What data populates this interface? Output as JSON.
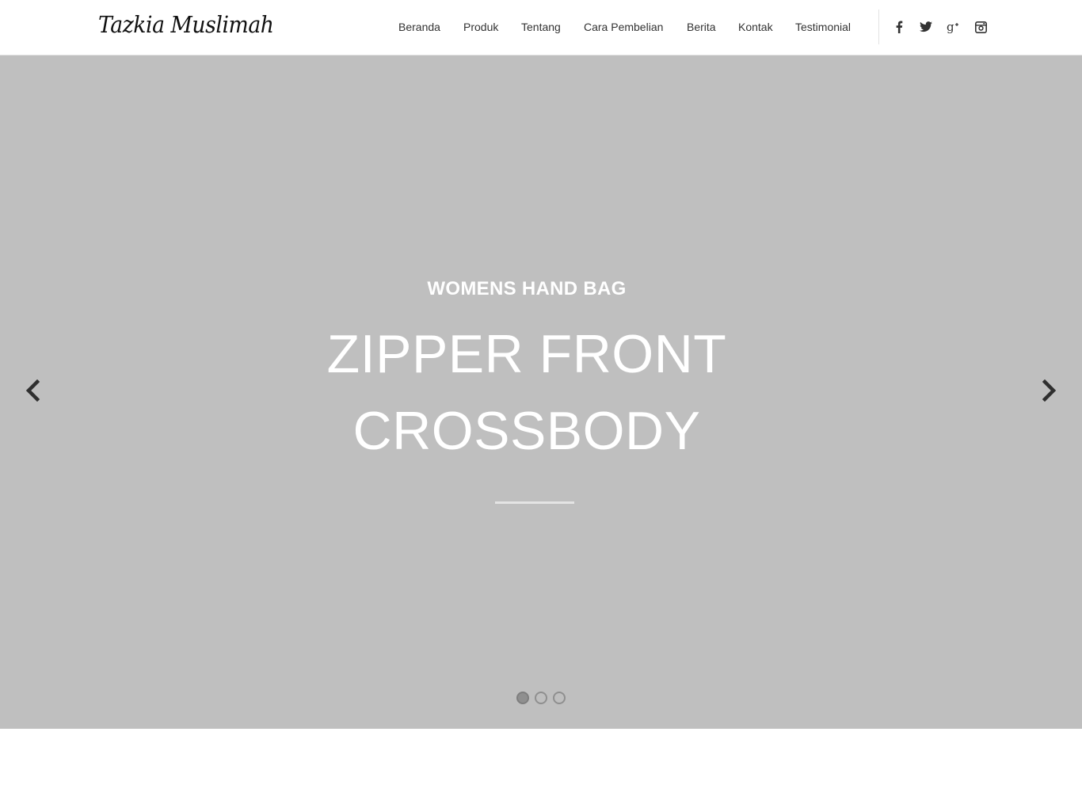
{
  "header": {
    "logo_text": "Tazkia Muslimah",
    "nav": [
      {
        "label": "Beranda"
      },
      {
        "label": "Produk"
      },
      {
        "label": "Tentang"
      },
      {
        "label": "Cara Pembelian"
      },
      {
        "label": "Berita"
      },
      {
        "label": "Kontak"
      },
      {
        "label": "Testimonial"
      }
    ],
    "social": [
      {
        "icon": "facebook-icon"
      },
      {
        "icon": "twitter-icon"
      },
      {
        "icon": "google-plus-icon"
      },
      {
        "icon": "instagram-icon"
      }
    ]
  },
  "slider": {
    "kicker": "WOMENS HAND BAG",
    "headline_line1": "ZIPPER FRONT",
    "headline_line2": "CROSSBODY",
    "slide_count": 3,
    "active_slide": 1,
    "prev_icon": "chevron-left-icon",
    "next_icon": "chevron-right-icon"
  },
  "colors": {
    "hero_background": "#bfbfbf",
    "hero_text": "#ffffff",
    "nav_text": "#333333",
    "arrow": "#2f2f2f"
  }
}
